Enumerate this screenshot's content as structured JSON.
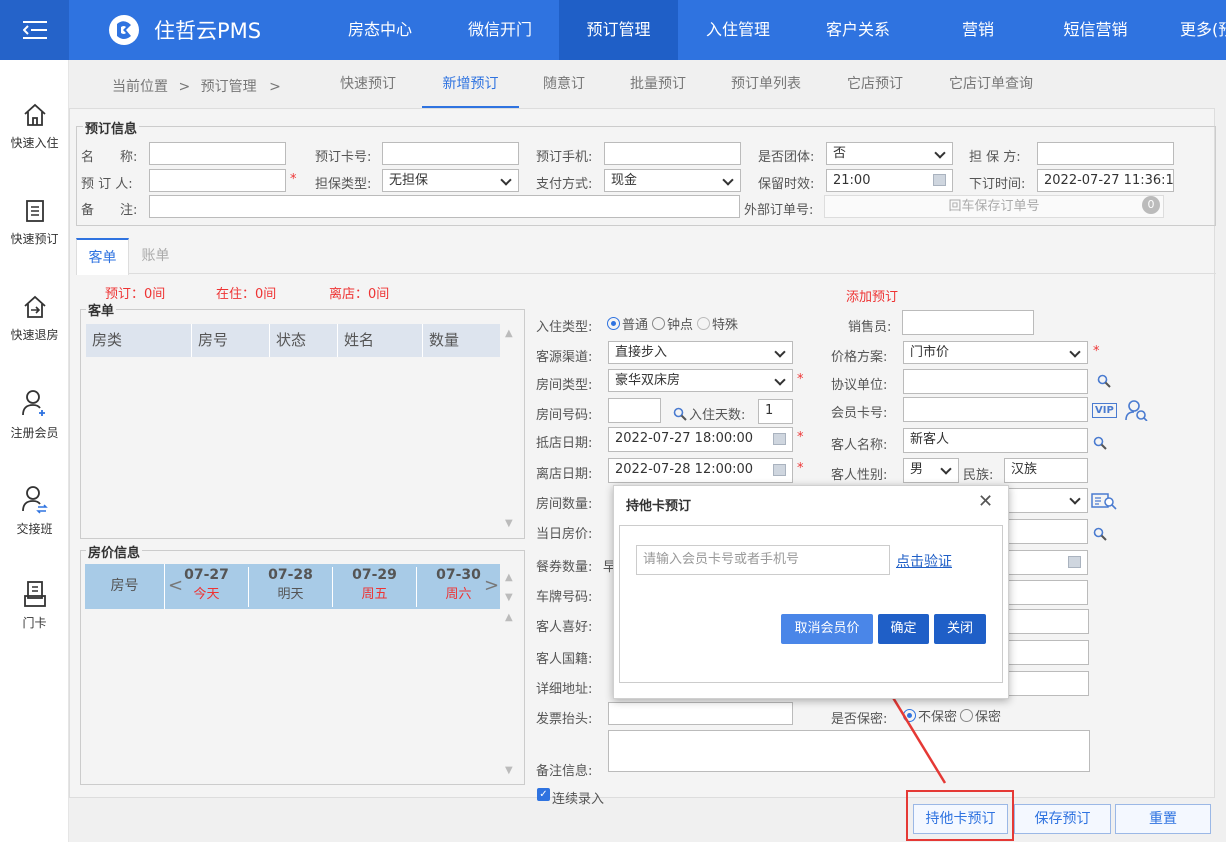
{
  "brand": {
    "name": "住哲云PMS"
  },
  "nav": [
    "房态中心",
    "微信开门",
    "预订管理",
    "入住管理",
    "客户关系",
    "营销",
    "短信营销",
    "更多(预"
  ],
  "nav_active": "预订管理",
  "sidebar": [
    {
      "label": "快速入住",
      "icon": "home-icon"
    },
    {
      "label": "快速预订",
      "icon": "document-icon"
    },
    {
      "label": "快速退房",
      "icon": "checkout-icon"
    },
    {
      "label": "注册会员",
      "icon": "add-user-icon"
    },
    {
      "label": "交接班",
      "icon": "shift-user-icon"
    },
    {
      "label": "门卡",
      "icon": "card-icon"
    }
  ],
  "breadcrumb": {
    "label": "当前位置",
    "sep1": ">",
    "section": "预订管理",
    "sep2": ">"
  },
  "tabs": [
    "快速预订",
    "新增预订",
    "随意订",
    "批量预订",
    "预订单列表",
    "它店预订",
    "它店订单查询"
  ],
  "booking_info": {
    "title": "预订信息",
    "name_label": "名　　称:",
    "card_label": "预订卡号:",
    "phone_label": "预订手机:",
    "group_label": "是否团体:",
    "group_value": "否",
    "guarantor_label": "担 保 方:",
    "booker_label": "预 订 人:",
    "guarantee_type_label": "担保类型:",
    "guarantee_type_value": "无担保",
    "payment_label": "支付方式:",
    "payment_value": "现金",
    "hold_label": "保留时效:",
    "hold_value": "21:00",
    "order_time_label": "下订时间:",
    "order_time_value": "2022-07-27 11:36:1",
    "remark_label": "备　　注:",
    "external_label": "外部订单号:",
    "external_placeholder": "回车保存订单号",
    "external_count": "0"
  },
  "subtabs": [
    "客单",
    "账单"
  ],
  "stats": {
    "booked": "预订：0间",
    "in_house": "在住：0间",
    "departed": "离店：0间"
  },
  "guest_list": {
    "title": "客单",
    "columns": [
      "房类",
      "房号",
      "状态",
      "姓名",
      "数量"
    ]
  },
  "price_info": {
    "title": "房价信息",
    "room_col": "房号",
    "days": [
      {
        "date": "07-27",
        "day": "今天"
      },
      {
        "date": "07-28",
        "day": "明天"
      },
      {
        "date": "07-29",
        "day": "周五"
      },
      {
        "date": "07-30",
        "day": "周六"
      }
    ]
  },
  "form": {
    "add_booking": "添加预订",
    "checkin_type_label": "入住类型:",
    "checkin_types": [
      "普通",
      "钟点",
      "特殊"
    ],
    "salesperson_label": "销售员:",
    "source_label": "客源渠道:",
    "source_value": "直接步入",
    "price_plan_label": "价格方案:",
    "price_plan_value": "门市价",
    "room_type_label": "房间类型:",
    "room_type_value": "豪华双床房",
    "agreement_label": "协议单位:",
    "room_no_label": "房间号码:",
    "days_label": "入住天数:",
    "days_value": "1",
    "member_card_label": "会员卡号:",
    "vip": "VIP",
    "arrive_label": "抵店日期:",
    "arrive_value": "2022-07-27 18:00:00",
    "guest_name_label": "客人名称:",
    "guest_name_value": "新客人",
    "depart_label": "离店日期:",
    "depart_value": "2022-07-28 12:00:00",
    "gender_label": "客人性别:",
    "gender_value": "男",
    "ethnic_label": "民族:",
    "ethnic_value": "汉族",
    "room_count_label": "房间数量:",
    "day_price_label": "当日房价:",
    "meal_label": "餐券数量:",
    "meal_value_start": "早",
    "plate_label": "车牌号码:",
    "preference_label": "客人喜好:",
    "nationality_label": "客人国籍:",
    "address_label": "详细地址:",
    "invoice_label": "发票抬头:",
    "confidential_label": "是否保密:",
    "confidential_options": [
      "不保密",
      "保密"
    ],
    "note_label": "备注信息:",
    "continuous": "连续录入"
  },
  "buttons": {
    "card_booking": "持他卡预订",
    "save": "保存预订",
    "reset": "重置"
  },
  "modal": {
    "title": "持他卡预订",
    "close": "✕",
    "input_placeholder": "请输入会员卡号或者手机号",
    "verify": "点击验证",
    "cancel_member_price": "取消会员价",
    "confirm": "确定",
    "close_btn": "关闭"
  },
  "colors": {
    "primary": "#2f73e0",
    "highlight": "#e53935",
    "button_blue": "#1f5fc7",
    "button_light": "#4a86e8"
  }
}
